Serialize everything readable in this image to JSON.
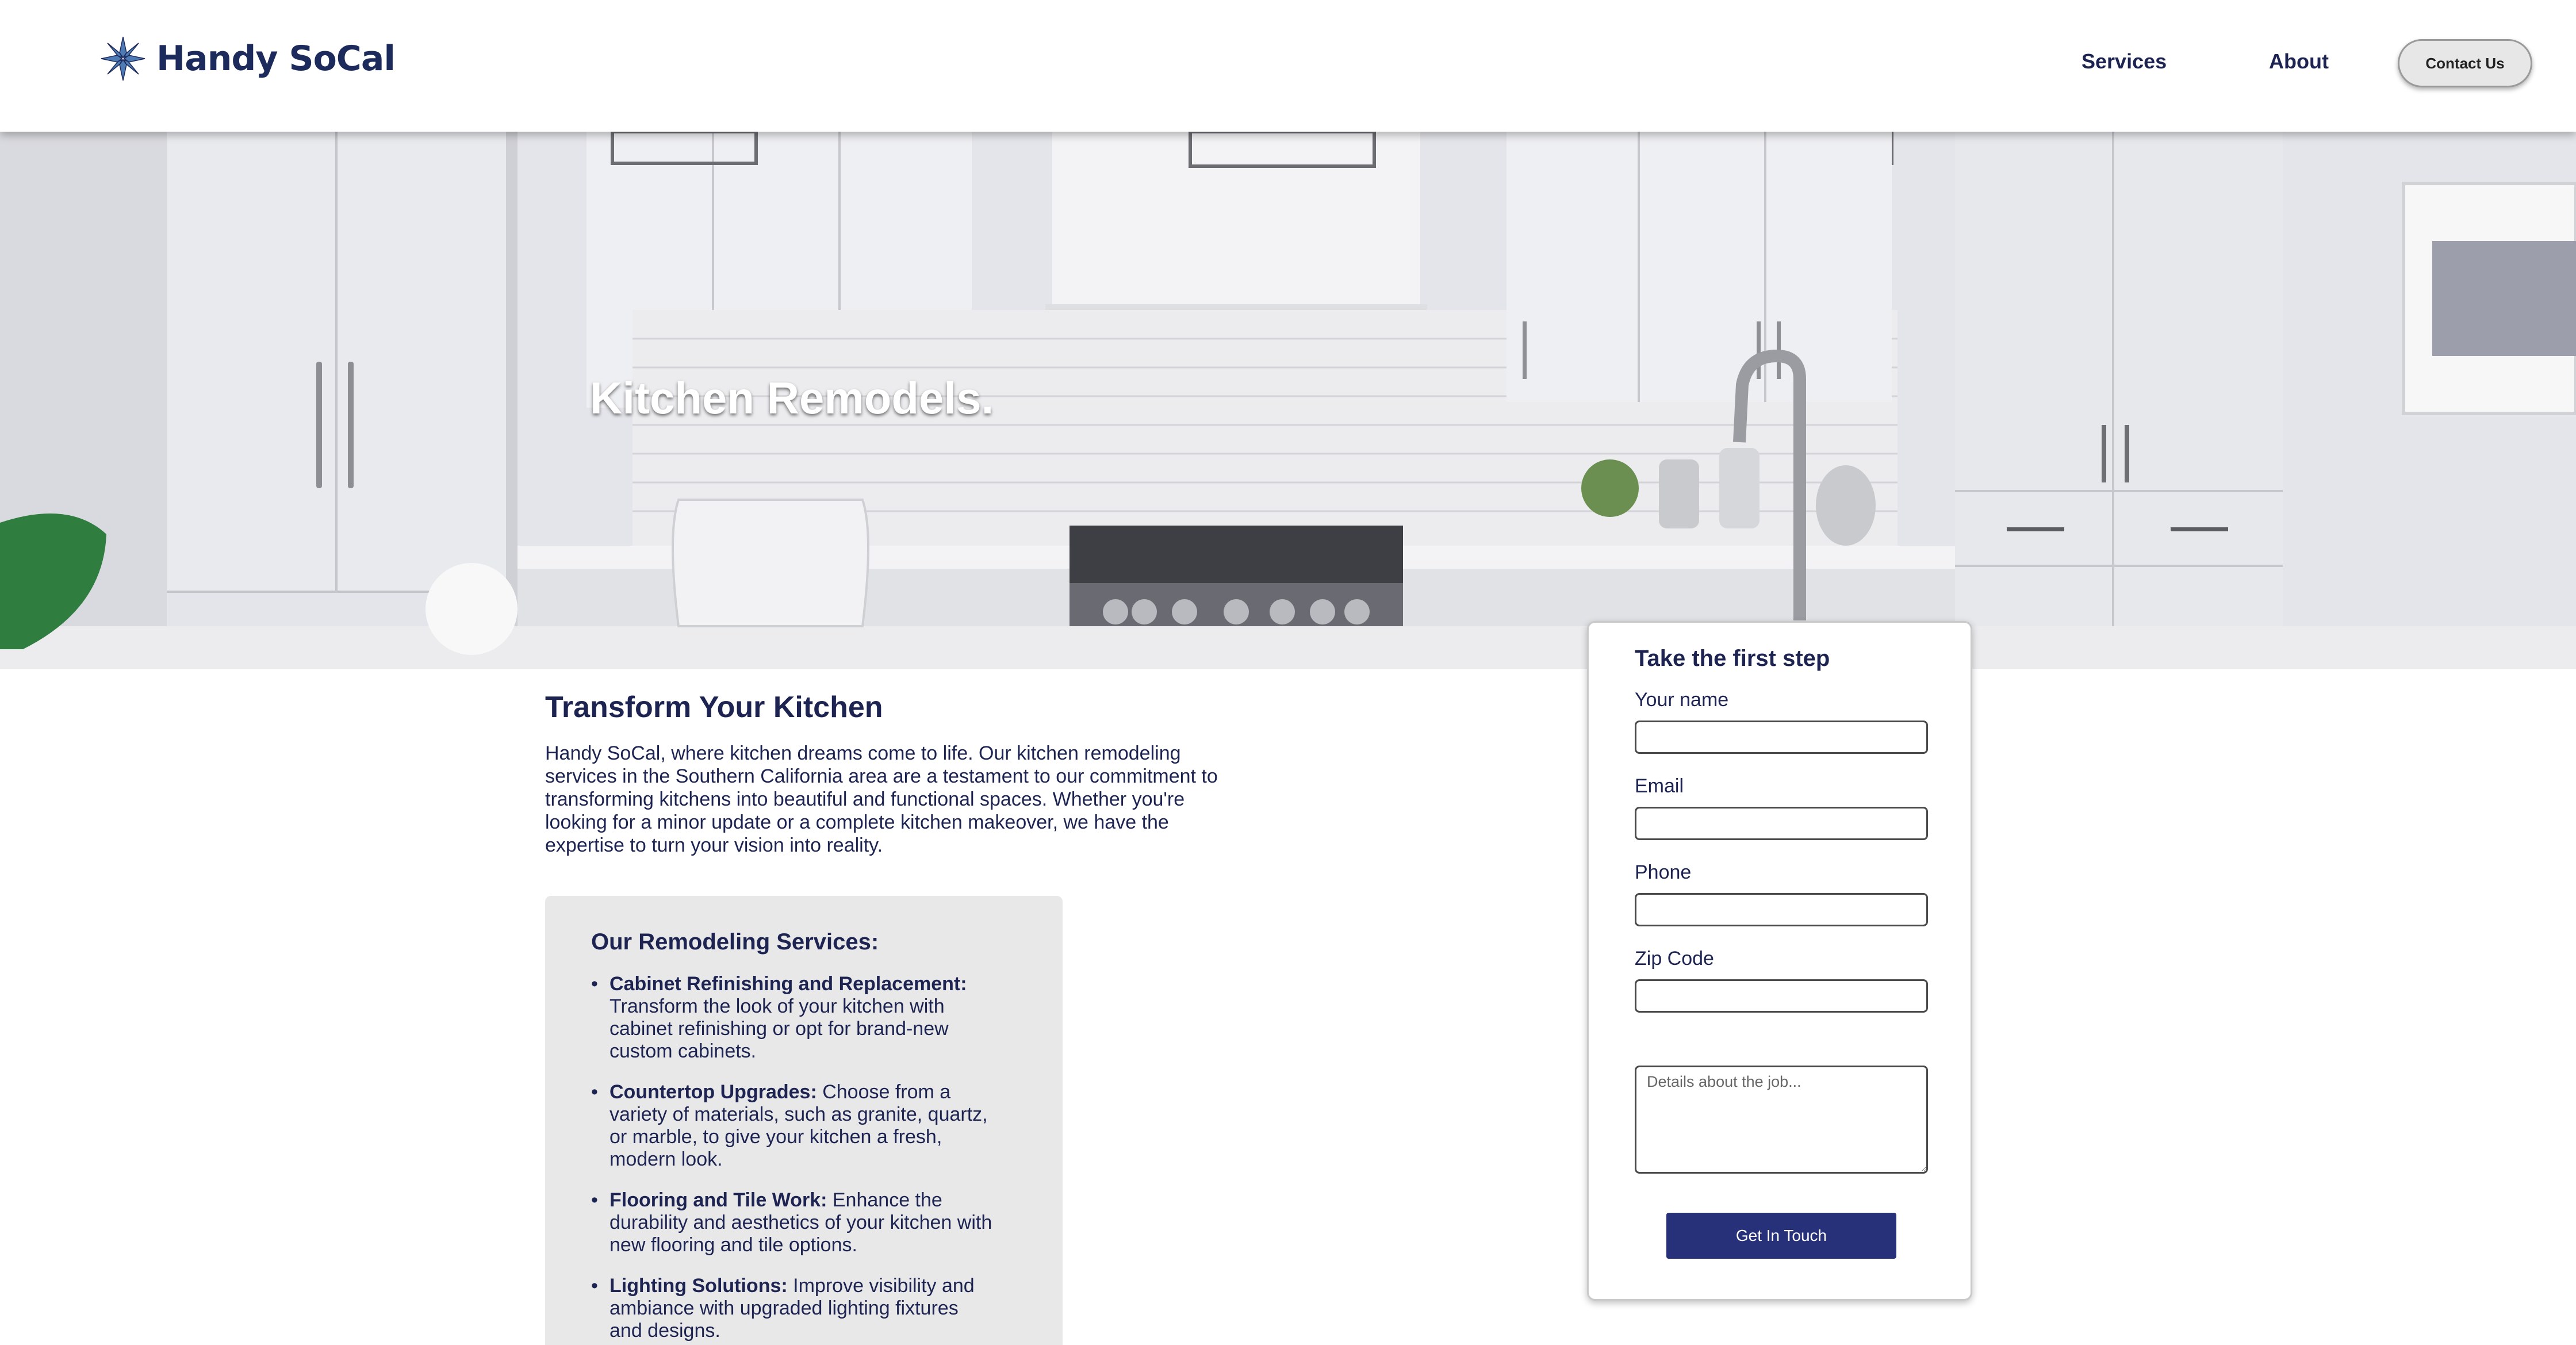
{
  "brand": {
    "name": "Handy SoCal",
    "logo_icon": "snowflake-star-icon",
    "color": "#1d2a5c"
  },
  "nav": {
    "services": "Services",
    "about": "About",
    "contact": "Contact Us"
  },
  "hero": {
    "title": "Kitchen Remodels."
  },
  "main": {
    "title": "Transform Your Kitchen",
    "intro": "Handy SoCal, where kitchen dreams come to life. Our kitchen remodeling services in the Southern California area are a testament to our commitment to transforming kitchens into beautiful and functional spaces. Whether you're looking for a minor update or a complete kitchen makeover, we have the expertise to turn your vision into reality.",
    "services_heading": "Our Remodeling Services:",
    "services": [
      {
        "name": "Cabinet Refinishing and Replacement:",
        "desc": "Transform the look of your kitchen with cabinet refinishing or opt for brand-new custom cabinets."
      },
      {
        "name": "Countertop Upgrades:",
        "desc": "Choose from a variety of materials, such as granite, quartz, or marble, to give your kitchen a fresh, modern look."
      },
      {
        "name": "Flooring and Tile Work:",
        "desc": "Enhance the durability and aesthetics of your kitchen with new flooring and tile options."
      },
      {
        "name": "Lighting Solutions:",
        "desc": "Improve visibility and ambiance with upgraded lighting fixtures and designs."
      }
    ]
  },
  "form": {
    "title": "Take the first step",
    "name_label": "Your name",
    "email_label": "Email",
    "phone_label": "Phone",
    "zip_label": "Zip Code",
    "name_value": "",
    "email_value": "",
    "phone_value": "",
    "zip_value": "",
    "details_placeholder": "Details about the job...",
    "submit": "Get In Touch"
  },
  "colors": {
    "accent": "#27317a",
    "text": "#1d2452",
    "panel": "#e8e8e8"
  }
}
